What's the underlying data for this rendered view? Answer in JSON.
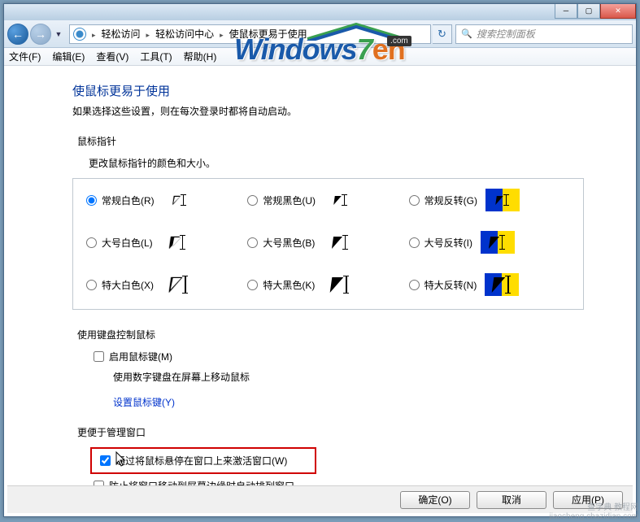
{
  "window_controls": {
    "min": "─",
    "max": "▢",
    "close": "✕"
  },
  "nav": {
    "back": "←",
    "forward": "→",
    "dropdown": "▼",
    "refresh": "↻"
  },
  "breadcrumb": {
    "item1": "轻松访问",
    "item2": "轻松访问中心",
    "item3": "使鼠标更易于使用"
  },
  "search_placeholder": "搜索控制面板",
  "menu": {
    "file": "文件(F)",
    "edit": "编辑(E)",
    "view": "查看(V)",
    "tools": "工具(T)",
    "help": "帮助(H)"
  },
  "heading": "使鼠标更易于使用",
  "subheading": "如果选择这些设置，则在每次登录时都将自动启动。",
  "section_pointer": "鼠标指针",
  "pointer_desc": "更改鼠标指针的颜色和大小。",
  "cursors": {
    "r1c1": "常规白色(R)",
    "r1c2": "常规黑色(U)",
    "r1c3": "常规反转(G)",
    "r2c1": "大号白色(L)",
    "r2c2": "大号黑色(B)",
    "r2c3": "大号反转(I)",
    "r3c1": "特大白色(X)",
    "r3c2": "特大黑色(K)",
    "r3c3": "特大反转(N)"
  },
  "section_keyboard": "使用键盘控制鼠标",
  "mousekeys_label": "启用鼠标键(M)",
  "mousekeys_desc": "使用数字键盘在屏幕上移动鼠标",
  "mousekeys_link": "设置鼠标键(Y)",
  "section_windows": "更便于管理窗口",
  "hover_activate": "通过将鼠标悬停在窗口上来激活窗口(W)",
  "prevent_arrange": "防止将窗口移动到屏幕边缘时自动排列窗口",
  "buttons": {
    "ok": "确定(O)",
    "cancel": "取消",
    "apply": "应用(P)"
  },
  "logo": {
    "win": "Windows",
    "seven": "7",
    "en": "en",
    "com": ".com"
  },
  "watermark": {
    "line1": "查字典 教程网",
    "line2": "jiaocheng.chazidian.com"
  }
}
